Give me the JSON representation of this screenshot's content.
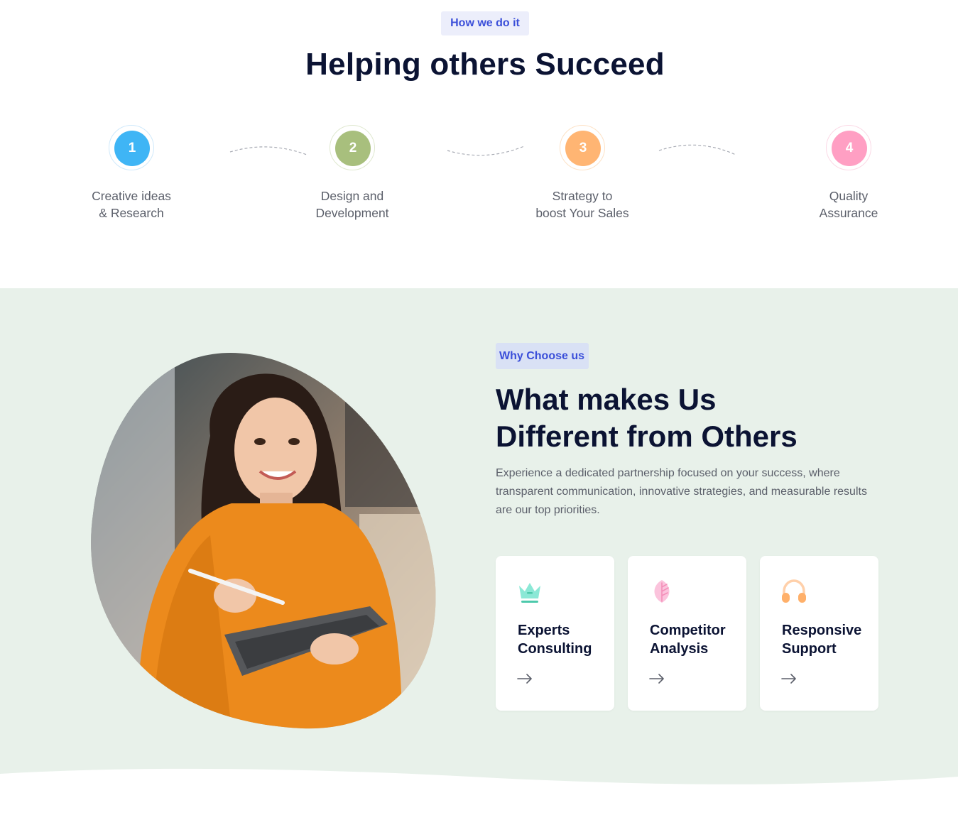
{
  "how_section": {
    "tag": "How we do it",
    "title": "Helping others Succeed",
    "steps": [
      {
        "number": "1",
        "line1": "Creative ideas",
        "line2": "& Research",
        "color": "#3fb5f5",
        "ring": "#cfe9fb"
      },
      {
        "number": "2",
        "line1": "Design and",
        "line2": "Development",
        "color": "#a8bf7d",
        "ring": "#dfe8cf"
      },
      {
        "number": "3",
        "line1": "Strategy to",
        "line2": "boost Your Sales",
        "color": "#ffb573",
        "ring": "#fde2c6"
      },
      {
        "number": "4",
        "line1": "Quality",
        "line2": "Assurance",
        "color": "#ff9fc3",
        "ring": "#fbd9e6"
      }
    ]
  },
  "why_section": {
    "tag": "Why Choose us",
    "title_line1": "What makes Us",
    "title_line2": "Different from Others",
    "description": "Experience a dedicated partnership focused on your success, where transparent communication, innovative strategies, and measurable results are our top priorities.",
    "cards": [
      {
        "title_line1": "Experts",
        "title_line2": "Consulting",
        "icon": "crown-icon",
        "icon_color": "#7fe3cf"
      },
      {
        "title_line1": "Competitor",
        "title_line2": "Analysis",
        "icon": "leaf-icon",
        "icon_color": "#f9b8d4"
      },
      {
        "title_line1": "Responsive",
        "title_line2": "Support",
        "icon": "headphones-icon",
        "icon_color": "#ffc08a"
      }
    ]
  },
  "colors": {
    "heading": "#0b1333",
    "accent": "#3b4fd9",
    "section_bg": "#e8f1ea",
    "body_text": "#5b5f6a"
  }
}
